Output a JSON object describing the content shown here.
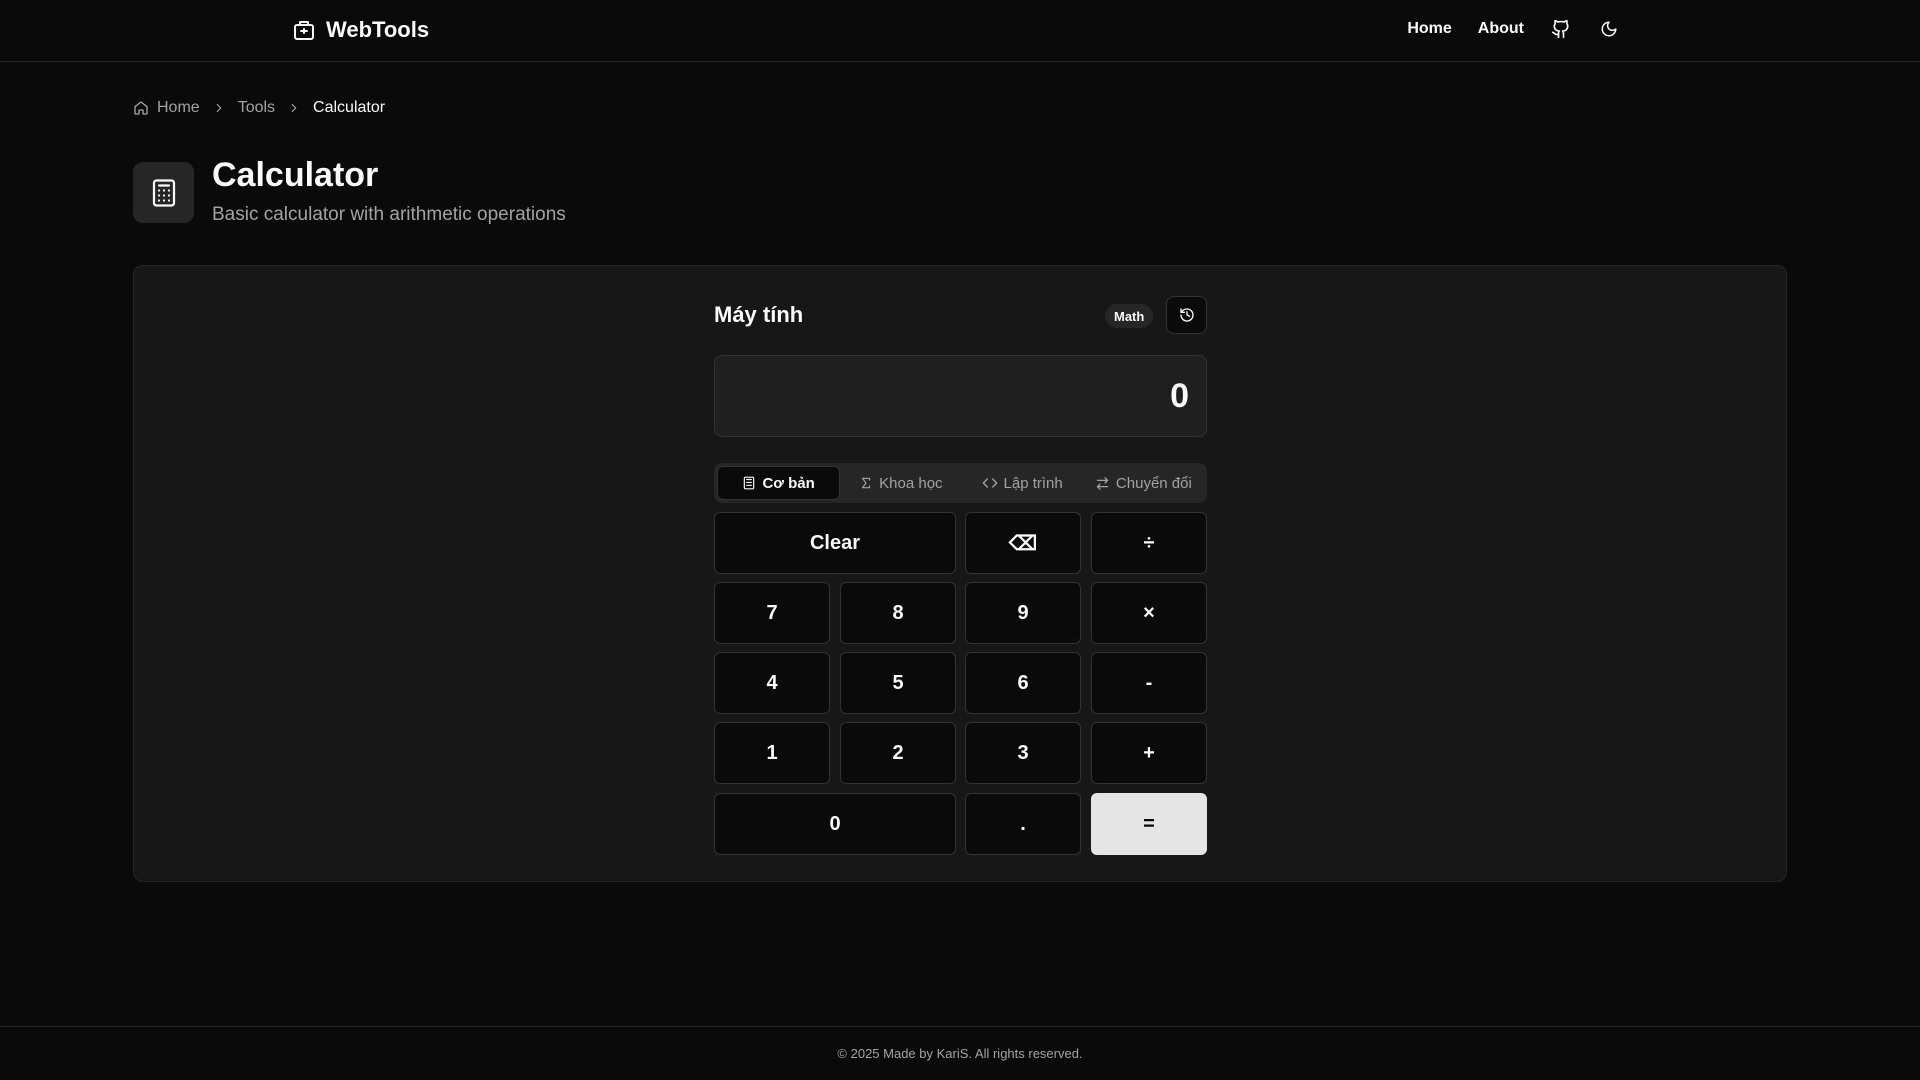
{
  "header": {
    "brand": "WebTools",
    "nav": {
      "home": "Home",
      "about": "About"
    }
  },
  "breadcrumb": {
    "home": "Home",
    "tools": "Tools",
    "current": "Calculator"
  },
  "page": {
    "title": "Calculator",
    "subtitle": "Basic calculator with arithmetic operations"
  },
  "calculator": {
    "title": "Máy tính",
    "badge": "Math",
    "display": "0",
    "tabs": [
      {
        "label": "Cơ bản",
        "icon": "calculator-icon",
        "active": true
      },
      {
        "label": "Khoa học",
        "icon": "sigma-icon",
        "active": false
      },
      {
        "label": "Lập trình",
        "icon": "code-icon",
        "active": false
      },
      {
        "label": "Chuyển đổi",
        "icon": "swap-icon",
        "active": false
      }
    ],
    "keys": {
      "clear": "Clear",
      "backspace": "⌫",
      "divide": "÷",
      "seven": "7",
      "eight": "8",
      "nine": "9",
      "multiply": "×",
      "four": "4",
      "five": "5",
      "six": "6",
      "minus": "-",
      "one": "1",
      "two": "2",
      "three": "3",
      "plus": "+",
      "zero": "0",
      "dot": ".",
      "equals": "="
    }
  },
  "footer": {
    "text": "© 2025 Made by KariS. All rights reserved."
  },
  "colors": {
    "background": "#0a0a0a",
    "card": "#171717",
    "border": "#262626",
    "muted_text": "#a3a3a3",
    "equals_button": "#e5e5e5"
  }
}
